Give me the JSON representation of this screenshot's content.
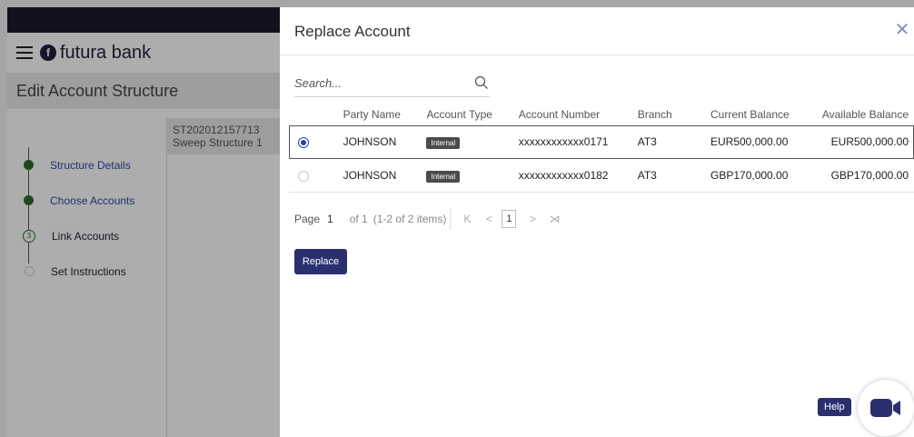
{
  "app": {
    "brand": "futura bank",
    "logo_mark": "f",
    "page_title": "Edit Account Structure",
    "structure_id": "ST202012157713",
    "structure_name": "Sweep Structure 1",
    "steps": [
      {
        "label": "Structure Details",
        "state": "done",
        "marker": ""
      },
      {
        "label": "Choose Accounts",
        "state": "done",
        "marker": ""
      },
      {
        "label": "Link Accounts",
        "state": "current",
        "marker": "3"
      },
      {
        "label": "Set Instructions",
        "state": "todo",
        "marker": ""
      }
    ]
  },
  "modal": {
    "title": "Replace Account",
    "close_icon": "close-icon",
    "search": {
      "placeholder": "Search...",
      "value": "",
      "icon": "search-icon"
    },
    "columns": [
      "Party Name",
      "Account Type",
      "Account Number",
      "Branch",
      "Current Balance",
      "Available Balance"
    ],
    "rows": [
      {
        "selected": true,
        "party_name": "JOHNSON",
        "account_type": "Internal",
        "account_number": "xxxxxxxxxxxx0171",
        "branch": "AT3",
        "current_balance": "EUR500,000.00",
        "available_balance": "EUR500,000.00"
      },
      {
        "selected": false,
        "party_name": "JOHNSON",
        "account_type": "Internal",
        "account_number": "xxxxxxxxxxxx0182",
        "branch": "AT3",
        "current_balance": "GBP170,000.00",
        "available_balance": "GBP170,000.00"
      }
    ],
    "pagination": {
      "page_label": "Page",
      "page_value": "1",
      "of_text": "of 1",
      "items_text": "(1-2 of 2 items)",
      "first": "K",
      "prev": "<",
      "current": "1",
      "next": ">",
      "last": "⋊"
    },
    "replace_label": "Replace",
    "help_label": "Help",
    "video_icon": "video-camera-icon"
  },
  "colors": {
    "primary": "#2a2f6e",
    "step_done": "#2f6b2f",
    "badge": "#4b4b4b",
    "overlay": "rgba(0,0,0,0.32)"
  }
}
